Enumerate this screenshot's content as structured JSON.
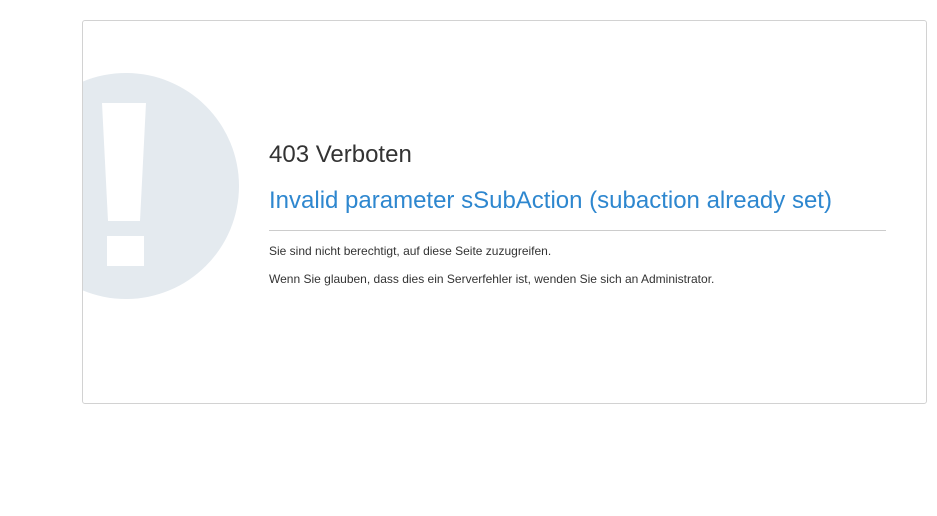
{
  "error": {
    "code_title": "403 Verboten",
    "message": "Invalid parameter sSubAction (subaction already set)",
    "description": "Sie sind nicht berechtigt, auf diese Seite zuzugreifen.",
    "hint": "Wenn Sie glauben, dass dies ein Serverfehler ist, wenden Sie sich an Administrator."
  },
  "icons": {
    "alert": "exclamation-icon"
  },
  "colors": {
    "message": "#2e87cf",
    "icon_circle": "#e4eaef",
    "border": "#d2d2d2",
    "text": "#333333"
  }
}
